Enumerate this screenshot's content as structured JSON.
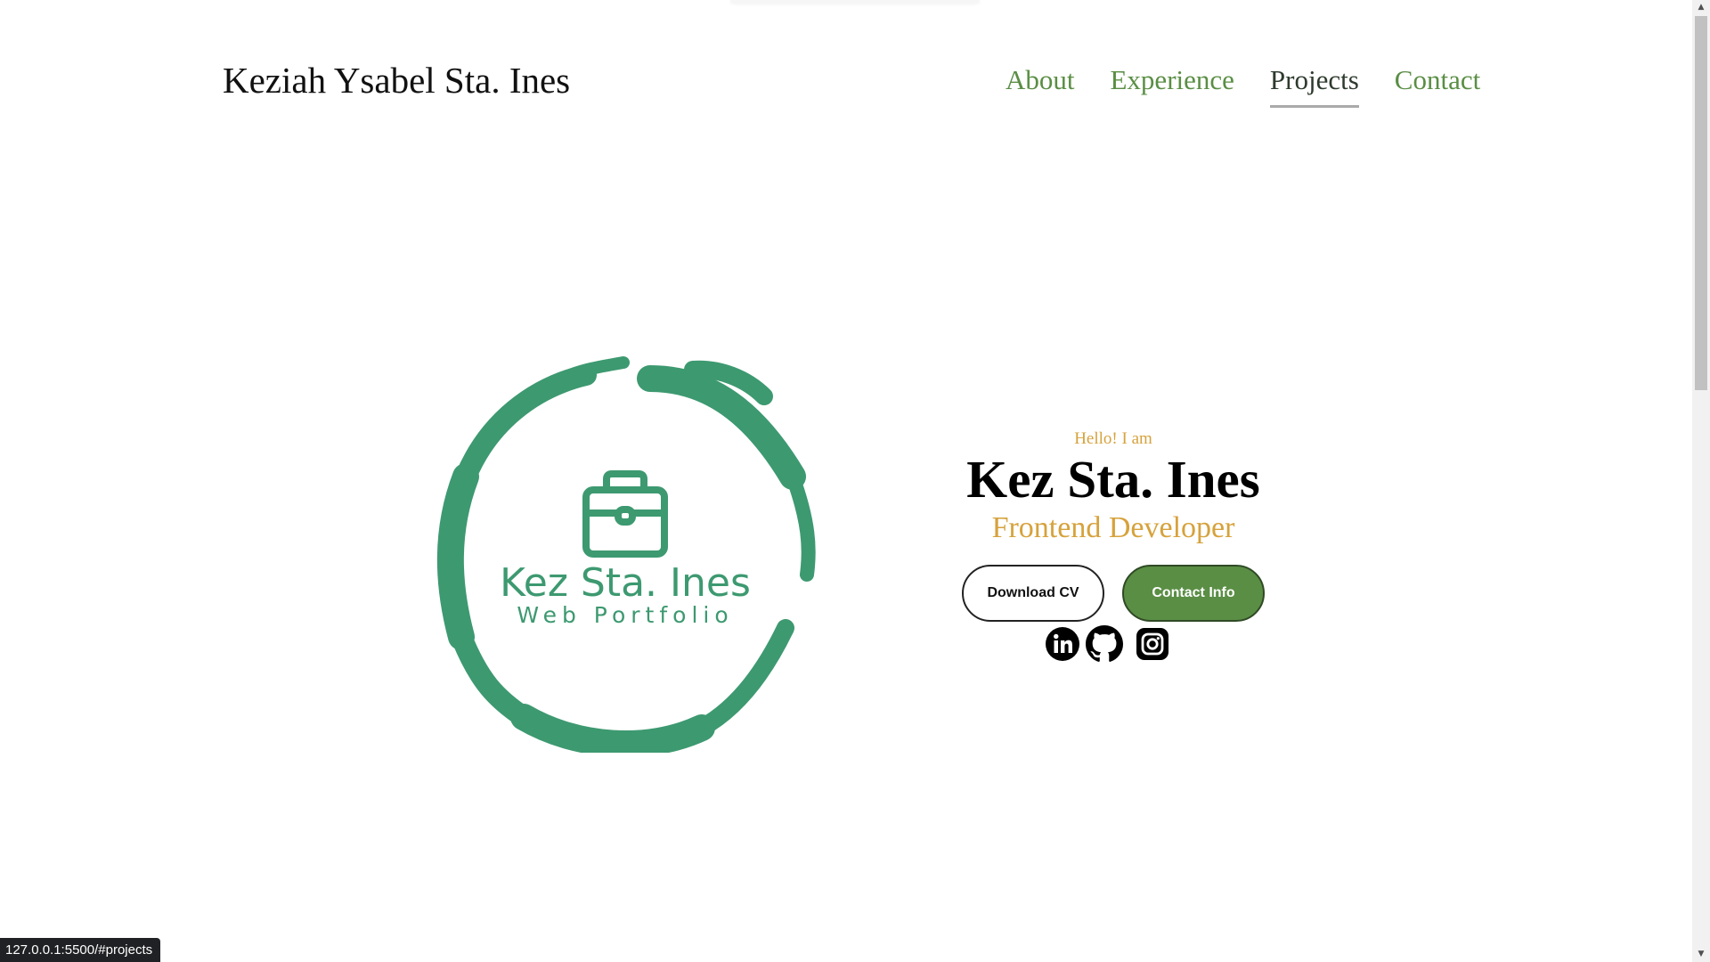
{
  "header": {
    "site_title": "Keziah Ysabel Sta. Ines",
    "nav": [
      {
        "label": "About"
      },
      {
        "label": "Experience"
      },
      {
        "label": "Projects",
        "active": true
      },
      {
        "label": "Contact"
      }
    ]
  },
  "hero": {
    "logo": {
      "name": "Kez Sta. Ines",
      "subtitle": "Web Portfolio",
      "icon": "briefcase-icon",
      "color": "#3d9970"
    },
    "greeting": "Hello! I am",
    "name": "Kez Sta. Ines",
    "role": "Frontend Developer",
    "buttons": {
      "download_cv": "Download CV",
      "contact_info": "Contact Info"
    },
    "socials": [
      "linkedin-icon",
      "github-icon",
      "instagram-icon"
    ]
  },
  "status_bar": {
    "url": "127.0.0.1:5500/#projects"
  },
  "colors": {
    "accent_green": "#5a8e44",
    "gold": "#d6a23c",
    "logo_green": "#3d9970"
  }
}
